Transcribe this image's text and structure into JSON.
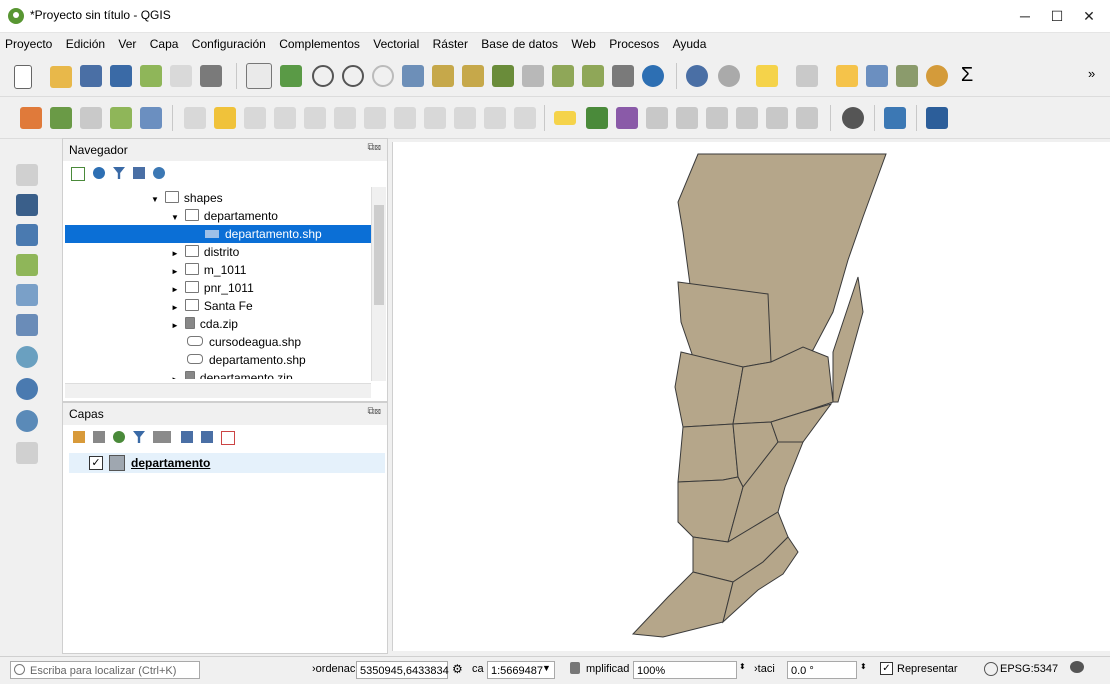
{
  "window": {
    "title": "*Proyecto sin título - QGIS",
    "minimize": "─",
    "maximize": "☐",
    "close": "✕"
  },
  "menu": [
    "Proyecto",
    "Edición",
    "Ver",
    "Capa",
    "Configuración",
    "Complementos",
    "Vectorial",
    "Ráster",
    "Base de datos",
    "Web",
    "Procesos",
    "Ayuda"
  ],
  "toolbar_overflow": "»",
  "browser": {
    "title": "Navegador",
    "items": [
      {
        "label": "shapes",
        "level": 0,
        "expanded": true
      },
      {
        "label": "departamento",
        "level": 1,
        "expanded": true
      },
      {
        "label": "departamento.shp",
        "level": 2,
        "selected": true
      },
      {
        "label": "distrito",
        "level": 1
      },
      {
        "label": "m_1011",
        "level": 1
      },
      {
        "label": "pnr_1011",
        "level": 1
      },
      {
        "label": "Santa Fe",
        "level": 1
      },
      {
        "label": "cda.zip",
        "level": 1
      },
      {
        "label": "cursodeagua.shp",
        "level": 1
      },
      {
        "label": "departamento.shp",
        "level": 1
      },
      {
        "label": "departamento.zip",
        "level": 1
      }
    ]
  },
  "layers": {
    "title": "Capas",
    "items": [
      {
        "name": "departamento",
        "checked": true,
        "color": "#9fa7b0"
      }
    ]
  },
  "map": {
    "fill_color": "#b5a68a",
    "stroke_color": "#3a3a3a"
  },
  "status": {
    "search_placeholder": "Escriba para localizar (Ctrl+K)",
    "coord_label": "›ordenac",
    "coord_value": "5350945,6433834",
    "scale_label": "ca",
    "scale_value": "1:5669487",
    "magnifier_label": "mplificad",
    "magnifier_value": "100%",
    "rotation_label": "›taci",
    "rotation_value": "0.0 °",
    "render_label": "Representar",
    "crs": "EPSG:5347"
  }
}
